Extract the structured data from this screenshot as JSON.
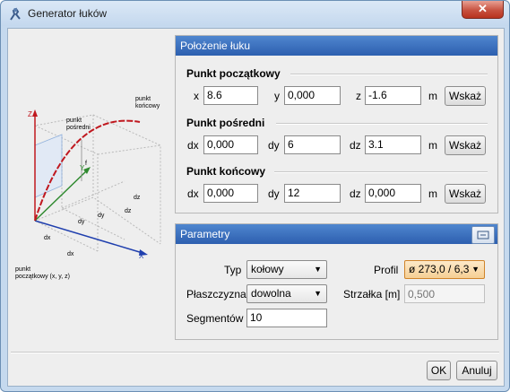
{
  "window": {
    "title": "Generator łuków",
    "close_symbol": "✕"
  },
  "diagram": {
    "labels": {
      "end_point": [
        "punkt",
        "końcowy"
      ],
      "mid_point": [
        "punkt",
        "pośredni"
      ],
      "start_point": [
        "punkt",
        "początkowy (x, y, z)"
      ],
      "z_axis": "Z",
      "y_axis": "Y",
      "x_axis": "X",
      "f": "f",
      "dz1": "dz",
      "dz2": "dz",
      "dy1": "dy",
      "dy2": "dy",
      "dx1": "dx",
      "dx2": "dx"
    }
  },
  "position_panel": {
    "title": "Położenie łuku",
    "start": {
      "title": "Punkt początkowy",
      "labels": [
        "x",
        "y",
        "z"
      ],
      "values": [
        "8.6",
        "0,000",
        "-1.6"
      ],
      "unit": "m",
      "button": "Wskaż"
    },
    "mid": {
      "title": "Punkt pośredni",
      "labels": [
        "dx",
        "dy",
        "dz"
      ],
      "values": [
        "0,000",
        "6",
        "3.1"
      ],
      "unit": "m",
      "button": "Wskaż"
    },
    "end": {
      "title": "Punkt końcowy",
      "labels": [
        "dx",
        "dy",
        "dz"
      ],
      "values": [
        "0,000",
        "12",
        "0,000"
      ],
      "unit": "m",
      "button": "Wskaż"
    }
  },
  "params_panel": {
    "title": "Parametry",
    "type_label": "Typ",
    "type_value": "kołowy",
    "plane_label": "Płaszczyzna",
    "plane_value": "dowolna",
    "segments_label": "Segmentów",
    "segments_value": "10",
    "profile_label": "Profil",
    "profile_value": "ø 273,0 / 6,3",
    "sag_label": "Strzałka [m]",
    "sag_placeholder": "0,500"
  },
  "footer": {
    "ok": "OK",
    "cancel": "Anuluj"
  },
  "colors": {
    "accent": "#2d5faf",
    "highlight": "#f6cf94",
    "arc": "#c0181f"
  }
}
